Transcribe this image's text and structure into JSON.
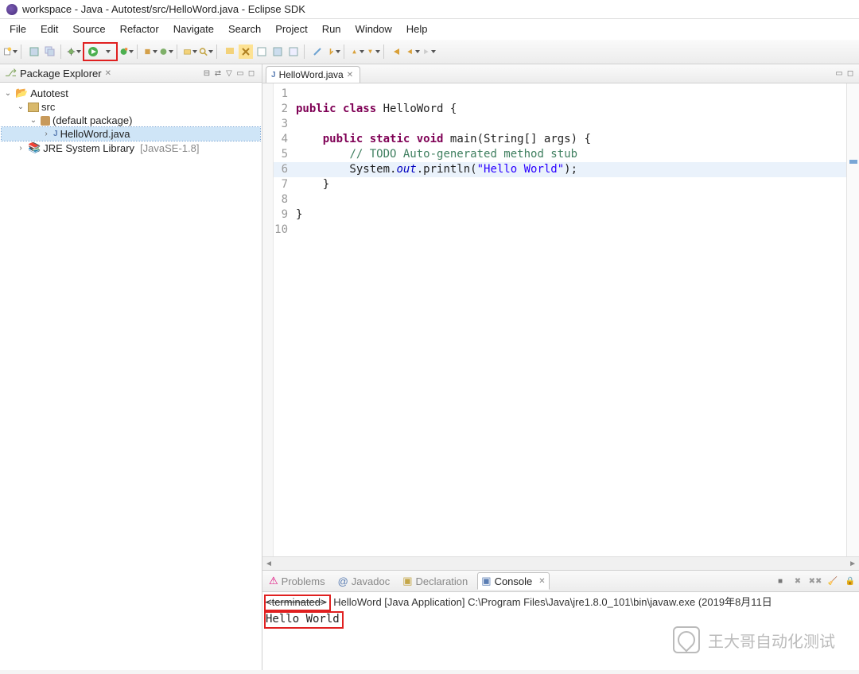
{
  "window": {
    "title": "workspace - Java - Autotest/src/HelloWord.java - Eclipse SDK"
  },
  "menu": [
    "File",
    "Edit",
    "Source",
    "Refactor",
    "Navigate",
    "Search",
    "Project",
    "Run",
    "Window",
    "Help"
  ],
  "package_explorer": {
    "title": "Package Explorer",
    "tree": {
      "project": "Autotest",
      "src": "src",
      "pkg": "(default package)",
      "file": "HelloWord.java",
      "lib": "JRE System Library",
      "lib_suffix": "[JavaSE-1.8]"
    }
  },
  "editor": {
    "tab": "HelloWord.java",
    "lines": {
      "l1": "",
      "l2a": "public",
      "l2b": "class",
      "l2c": " HelloWord {",
      "l3": "",
      "l4a": "    ",
      "l4b": "public",
      "l4c": " ",
      "l4d": "static",
      "l4e": " ",
      "l4f": "void",
      "l4g": " main(String[] args) {",
      "l5a": "        ",
      "l5b": "// TODO Auto-generated method stub",
      "l6a": "        System.",
      "l6b": "out",
      "l6c": ".println(",
      "l6d": "\"Hello World\"",
      "l6e": ");",
      "l7": "    }",
      "l8": "",
      "l9": "}",
      "l10": ""
    }
  },
  "bottom_tabs": {
    "problems": "Problems",
    "javadoc": "Javadoc",
    "declaration": "Declaration",
    "console": "Console"
  },
  "console": {
    "header_prefix": "<terminated>",
    "header_rest": " HelloWord [Java Application] C:\\Program Files\\Java\\jre1.8.0_101\\bin\\javaw.exe (2019年8月11日",
    "output": "Hello World"
  },
  "watermark": "王大哥自动化测试"
}
